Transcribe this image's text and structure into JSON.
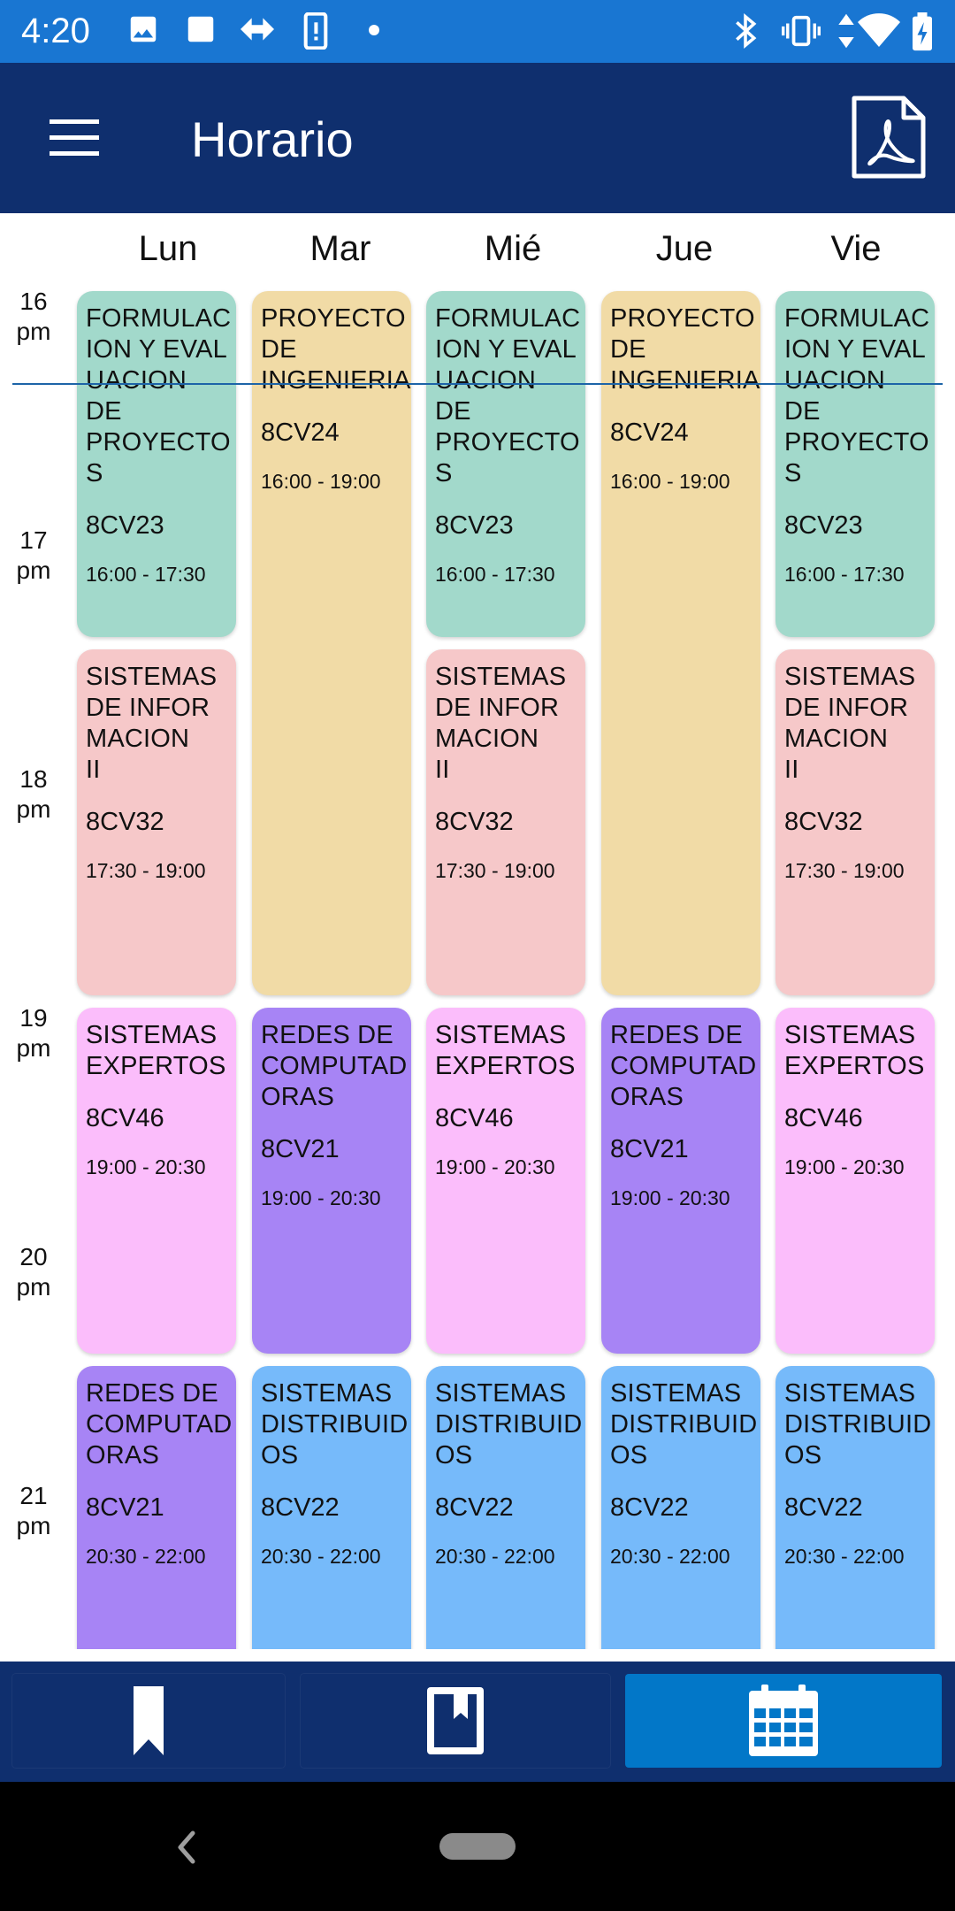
{
  "status_bar": {
    "time": "4:20"
  },
  "app_bar": {
    "title": "Horario"
  },
  "days": [
    "Lun",
    "Mar",
    "Mié",
    "Jue",
    "Vie"
  ],
  "time_labels": [
    {
      "hour": "16",
      "suffix": "pm"
    },
    {
      "hour": "17",
      "suffix": "pm"
    },
    {
      "hour": "18",
      "suffix": "pm"
    },
    {
      "hour": "19",
      "suffix": "pm"
    },
    {
      "hour": "20",
      "suffix": "pm"
    },
    {
      "hour": "21",
      "suffix": "pm"
    }
  ],
  "colors": {
    "status_bar": "#1976d2",
    "app_bar": "#0f2f6e",
    "nav_active": "#0277c8",
    "formulacion": "#a2d9cb",
    "proyecto": "#f1dba6",
    "sistemas_info": "#f6c8c9",
    "expertos": "#fbbdfb",
    "redes": "#a784f5",
    "distribuidos": "#76bafa"
  },
  "events": [
    {
      "day": 0,
      "name": "FORMULAC\nION Y EVAL\nUACION DE\nPROYECTO\nS",
      "group": "8CV23",
      "time": "16:00 - 17:30",
      "start": 16.0,
      "end": 17.5,
      "color": "#a2d9cb"
    },
    {
      "day": 0,
      "name": "SISTEMAS\nDE INFOR\nMACION\nII",
      "group": "8CV32",
      "time": "17:30 - 19:00",
      "start": 17.5,
      "end": 19.0,
      "color": "#f6c8c9"
    },
    {
      "day": 0,
      "name": "SISTEMAS\nEXPERTOS",
      "group": "8CV46",
      "time": "19:00 - 20:30",
      "start": 19.0,
      "end": 20.5,
      "color": "#fbbdfb"
    },
    {
      "day": 0,
      "name": "REDES DE\nCOMPUTAD\nORAS",
      "group": "8CV21",
      "time": "20:30 - 22:00",
      "start": 20.5,
      "end": 22.0,
      "color": "#a784f5"
    },
    {
      "day": 1,
      "name": "PROYECTO\nDE\nINGENIERIA",
      "group": "8CV24",
      "time": "16:00 - 19:00",
      "start": 16.0,
      "end": 19.0,
      "color": "#f1dba6"
    },
    {
      "day": 1,
      "name": "REDES DE\nCOMPUTAD\nORAS",
      "group": "8CV21",
      "time": "19:00 - 20:30",
      "start": 19.0,
      "end": 20.5,
      "color": "#a784f5"
    },
    {
      "day": 1,
      "name": "SISTEMAS\nDISTRIBUID\nOS",
      "group": "8CV22",
      "time": "20:30 - 22:00",
      "start": 20.5,
      "end": 22.0,
      "color": "#76bafa"
    },
    {
      "day": 2,
      "name": "FORMULAC\nION Y EVAL\nUACION DE\nPROYECTO\nS",
      "group": "8CV23",
      "time": "16:00 - 17:30",
      "start": 16.0,
      "end": 17.5,
      "color": "#a2d9cb"
    },
    {
      "day": 2,
      "name": "SISTEMAS\nDE INFOR\nMACION\nII",
      "group": "8CV32",
      "time": "17:30 - 19:00",
      "start": 17.5,
      "end": 19.0,
      "color": "#f6c8c9"
    },
    {
      "day": 2,
      "name": "SISTEMAS\nEXPERTOS",
      "group": "8CV46",
      "time": "19:00 - 20:30",
      "start": 19.0,
      "end": 20.5,
      "color": "#fbbdfb"
    },
    {
      "day": 2,
      "name": "SISTEMAS\nDISTRIBUID\nOS",
      "group": "8CV22",
      "time": "20:30 - 22:00",
      "start": 20.5,
      "end": 22.0,
      "color": "#76bafa"
    },
    {
      "day": 3,
      "name": "PROYECTO\nDE\nINGENIERIA",
      "group": "8CV24",
      "time": "16:00 - 19:00",
      "start": 16.0,
      "end": 19.0,
      "color": "#f1dba6"
    },
    {
      "day": 3,
      "name": "REDES DE\nCOMPUTAD\nORAS",
      "group": "8CV21",
      "time": "19:00 - 20:30",
      "start": 19.0,
      "end": 20.5,
      "color": "#a784f5"
    },
    {
      "day": 3,
      "name": "SISTEMAS\nDISTRIBUID\nOS",
      "group": "8CV22",
      "time": "20:30 - 22:00",
      "start": 20.5,
      "end": 22.0,
      "color": "#76bafa"
    },
    {
      "day": 4,
      "name": "FORMULAC\nION Y EVAL\nUACION DE\nPROYECTO\nS",
      "group": "8CV23",
      "time": "16:00 - 17:30",
      "start": 16.0,
      "end": 17.5,
      "color": "#a2d9cb"
    },
    {
      "day": 4,
      "name": "SISTEMAS\nDE INFOR\nMACION\nII",
      "group": "8CV32",
      "time": "17:30 - 19:00",
      "start": 17.5,
      "end": 19.0,
      "color": "#f6c8c9"
    },
    {
      "day": 4,
      "name": "SISTEMAS\nEXPERTOS",
      "group": "8CV46",
      "time": "19:00 - 20:30",
      "start": 19.0,
      "end": 20.5,
      "color": "#fbbdfb"
    },
    {
      "day": 4,
      "name": "SISTEMAS\nDISTRIBUID\nOS",
      "group": "8CV22",
      "time": "20:30 - 22:00",
      "start": 20.5,
      "end": 22.0,
      "color": "#76bafa"
    }
  ],
  "bottom_nav": [
    {
      "icon": "bookmark-icon",
      "active": false
    },
    {
      "icon": "book-icon",
      "active": false
    },
    {
      "icon": "calendar-icon",
      "active": true
    }
  ]
}
